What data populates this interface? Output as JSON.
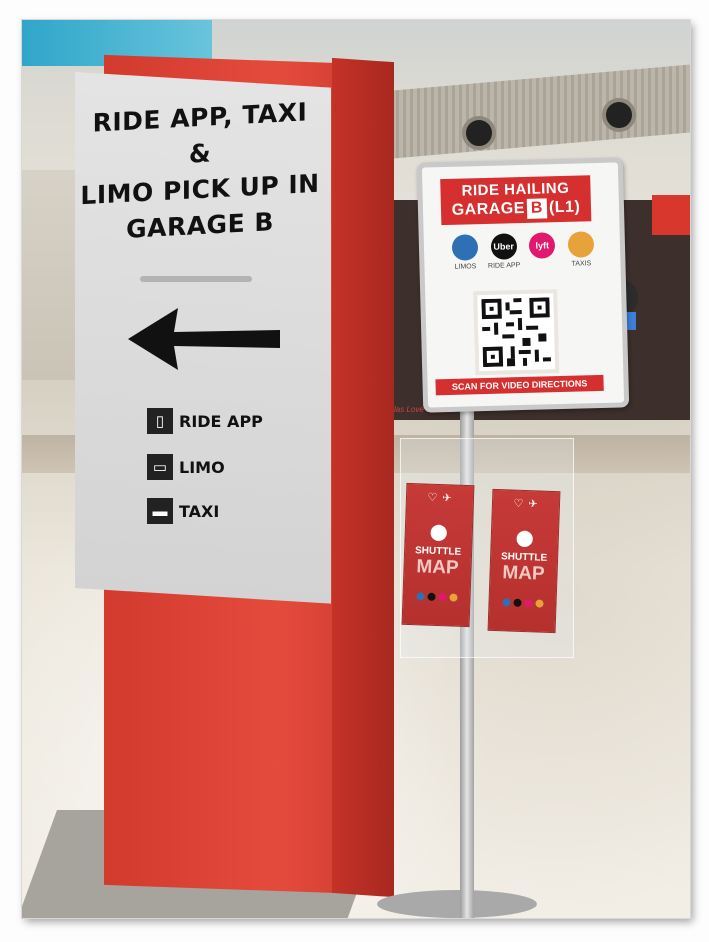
{
  "totem_sign": {
    "title_lines": [
      "RIDE APP, TAXI &",
      "LIMO PICK UP IN",
      "GARAGE B"
    ],
    "arrow": "arrow-left-icon",
    "legend": [
      {
        "icon": "ride-app-icon",
        "label": "RIDE APP"
      },
      {
        "icon": "limo-icon",
        "label": "LIMO"
      },
      {
        "icon": "taxi-icon",
        "label": "TAXI"
      }
    ],
    "colors": {
      "red": "#e1473a",
      "panel": "#dcdcdc"
    }
  },
  "qr_card": {
    "title": "RIDE HAILING",
    "subtitle_prefix": "GARAGE",
    "subtitle_letter": "B",
    "subtitle_suffix": "(L1)",
    "brands": [
      {
        "name": "Limos",
        "logo_text": "",
        "label": "LIMOS",
        "color": "#2f6fb3"
      },
      {
        "name": "Uber",
        "logo_text": "Uber",
        "label": "RIDE APP",
        "color": "#111111"
      },
      {
        "name": "Lyft",
        "logo_text": "lyft",
        "label": "",
        "color": "#e0196f"
      },
      {
        "name": "Taxis",
        "logo_text": "",
        "label": "TAXIS",
        "color": "#e8a23a"
      }
    ],
    "footer": "SCAN FOR VIDEO DIRECTIONS",
    "accent": "#d5302f"
  },
  "flyers": [
    {
      "shuttle": "SHUTTLE",
      "map": "MAP"
    },
    {
      "shuttle": "SHUTTLE",
      "map": "MAP"
    }
  ],
  "background": {
    "store_text": "Dallas Love Field"
  }
}
